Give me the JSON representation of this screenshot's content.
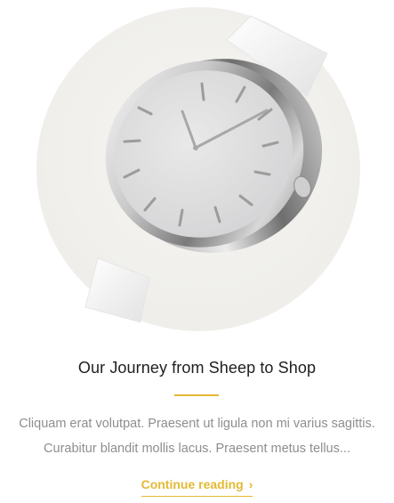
{
  "post": {
    "image_alt": "watch-product-image",
    "title": "Our Journey from Sheep to Shop",
    "excerpt_line1": "Cliquam erat volutpat. Praesent ut ligula non mi varius sagittis.",
    "excerpt_line2": "Curabitur blandit mollis lacus. Praesent metus tellus...",
    "read_more_label": "Continue reading",
    "read_more_icon": "chevron-right-icon"
  },
  "colors": {
    "accent": "#e4b934",
    "title": "#1e1e1e",
    "excerpt": "#8e8e8e",
    "image_circle": "#f1f0ee"
  }
}
